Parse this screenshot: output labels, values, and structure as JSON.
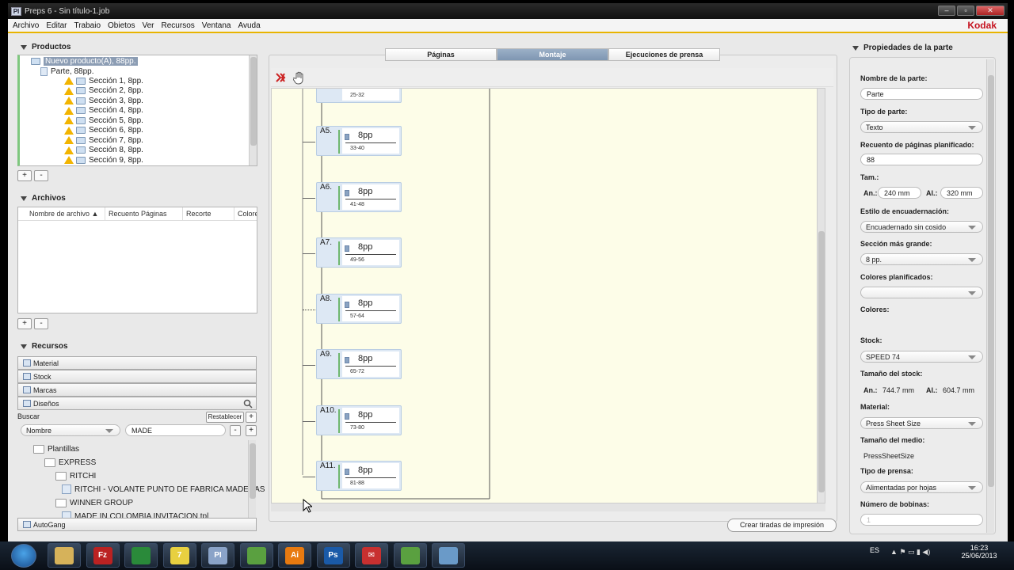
{
  "window": {
    "title": "Preps 6 - Sin título-1.job",
    "icon_text": "PI",
    "controls": [
      "–",
      "▫",
      "✕"
    ]
  },
  "menu": {
    "items": [
      "Archivo",
      "Editar",
      "Trabaio",
      "Obietos",
      "Ver",
      "Recursos",
      "Ventana",
      "Avuda"
    ],
    "brand": "Kodak"
  },
  "productos": {
    "title": "Productos",
    "root": "Nuevo producto(A), 88pp.",
    "part": "Parte, 88pp.",
    "sections": [
      "Sección 1, 8pp.",
      "Sección 2, 8pp.",
      "Sección 3, 8pp.",
      "Sección 4, 8pp.",
      "Sección 5, 8pp.",
      "Sección 6, 8pp.",
      "Sección 7, 8pp.",
      "Sección 8, 8pp.",
      "Sección 9, 8pp."
    ],
    "add": "+",
    "remove": "-"
  },
  "archivos": {
    "title": "Archivos",
    "columns": [
      "Nombre de archivo ▲",
      "Recuento Páginas",
      "Recorte",
      "Colore"
    ],
    "add": "+",
    "remove": "-"
  },
  "recursos": {
    "title": "Recursos",
    "tabs": [
      "Material",
      "Stock",
      "Marcas",
      "Diseños"
    ],
    "search_label": "Buscar",
    "reset": "Restablecer",
    "plus": "+",
    "minus": "-",
    "field": "Nombre",
    "query": "MADE",
    "tree": [
      "Plantillas",
      "EXPRESS",
      "RITCHI",
      "RITCHI - VOLANTE PUNTO DE FABRICA MADERAS",
      "WINNER GROUP",
      "MADE IN COLOMBIA INVITACION.tpl"
    ],
    "autogang": "AutoGang"
  },
  "center": {
    "tabs": [
      "Páginas",
      "Montaje",
      "Ejecuciones de prensa"
    ],
    "top_range": "25-32",
    "nodes": [
      {
        "id": "A5.",
        "pp": "8pp",
        "range": "33-40"
      },
      {
        "id": "A6.",
        "pp": "8pp",
        "range": "41-48"
      },
      {
        "id": "A7.",
        "pp": "8pp",
        "range": "49-56"
      },
      {
        "id": "A8.",
        "pp": "8pp",
        "range": "57-64"
      },
      {
        "id": "A9.",
        "pp": "8pp",
        "range": "65-72"
      },
      {
        "id": "A10.",
        "pp": "8pp",
        "range": "73-80"
      },
      {
        "id": "A11.",
        "pp": "8pp",
        "range": "81-88"
      }
    ],
    "create_button": "Crear tiradas de impresión"
  },
  "props": {
    "title": "Propiedades de la parte",
    "nombre_label": "Nombre de la parte:",
    "nombre": "Parte",
    "tipo_label": "Tipo de parte:",
    "tipo": "Texto",
    "recuento_label": "Recuento de páginas planificado:",
    "recuento": "88",
    "tam_label": "Tam.:",
    "an_label": "An.:",
    "an": "240 mm",
    "al_label": "Al.:",
    "al": "320 mm",
    "estilo_label": "Estilo de encuadernación:",
    "estilo": "Encuadernado sin cosido",
    "seccion_label": "Sección más grande:",
    "seccion": "8 pp.",
    "colores_plan_label": "Colores planificados:",
    "colores_label": "Colores:",
    "stock_label": "Stock:",
    "stock": "SPEED 74",
    "tam_stock_label": "Tamaño del stock:",
    "stock_an": "744.7 mm",
    "stock_al": "604.7 mm",
    "material_label": "Material:",
    "material": "Press Sheet Size",
    "medio_label": "Tamaño del medio:",
    "medio": "PressSheetSize",
    "prensa_label": "Tipo de prensa:",
    "prensa": "Alimentadas por hojas",
    "bobinas_label": "Número de bobinas:",
    "bobinas": "1"
  },
  "taskbar": {
    "apps": [
      "Explorer",
      "FileZilla",
      "Chrome",
      "Notepad",
      "Preps",
      "App",
      "Illustrator",
      "Photoshop",
      "Mail",
      "App",
      "Files"
    ],
    "labels": [
      "",
      "Fz",
      "",
      "7",
      "PI",
      "",
      "Ai",
      "Ps",
      "✉",
      "",
      ""
    ],
    "lang": "ES",
    "time": "16:23",
    "date": "25/06/2013"
  }
}
